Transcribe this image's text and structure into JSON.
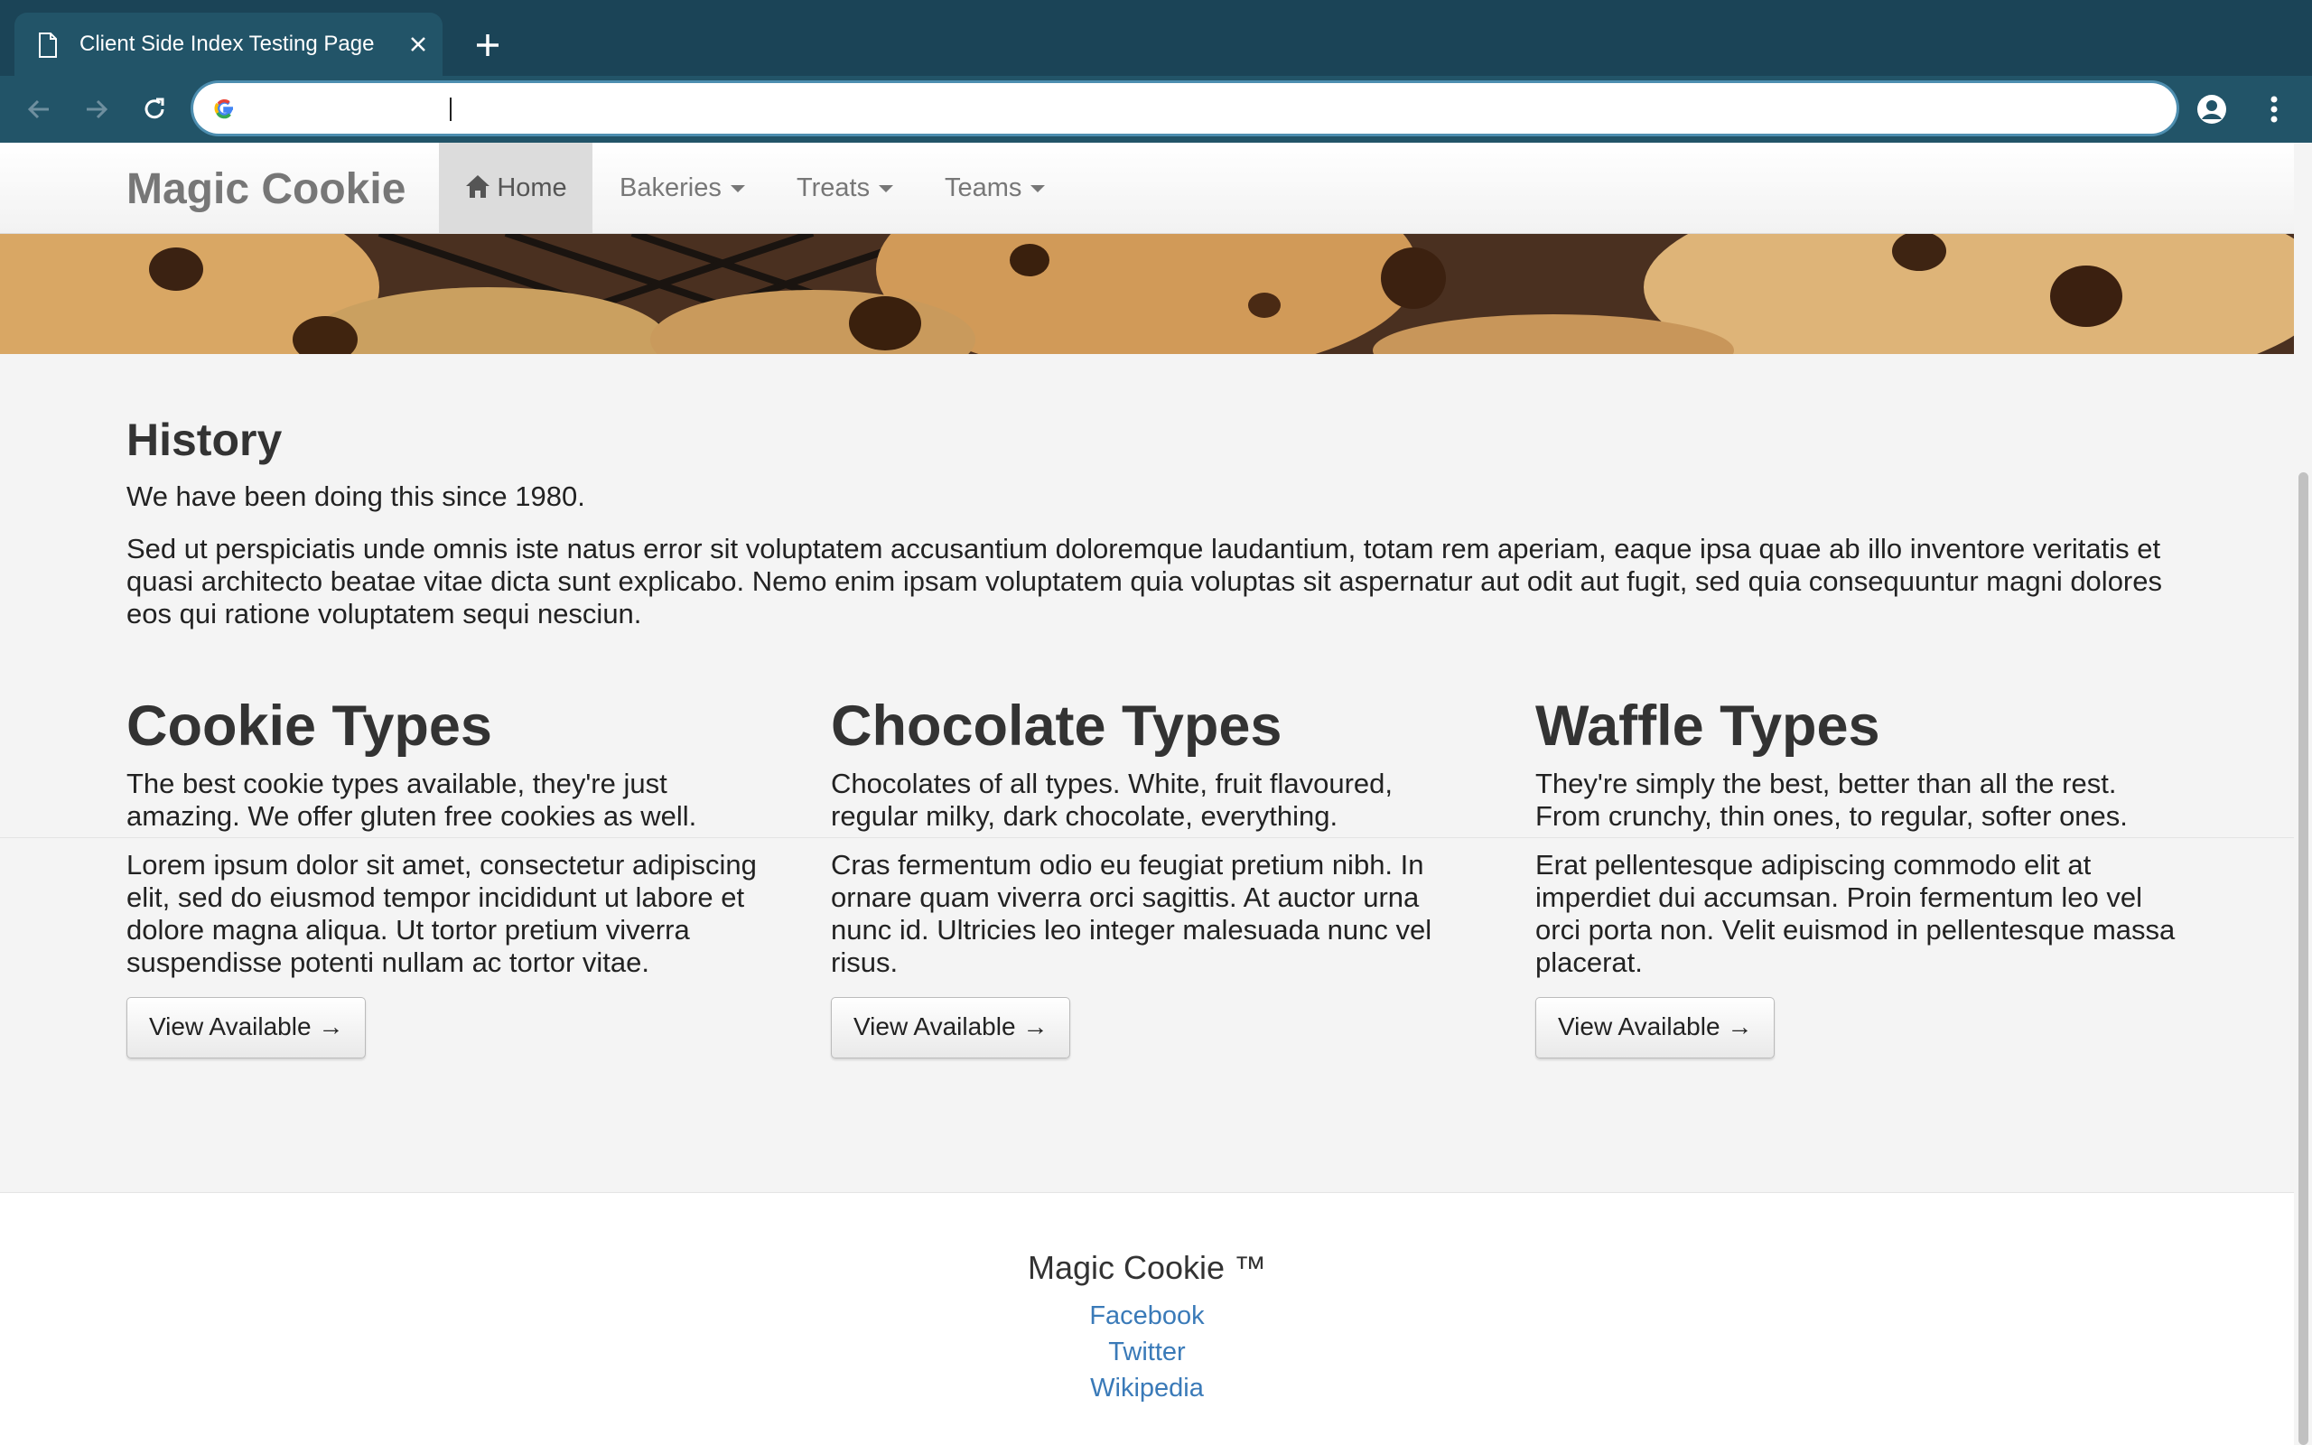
{
  "browser": {
    "tab_title": "Client Side Index Testing Page",
    "address_value": "",
    "accent_color": "#1b4457"
  },
  "nav": {
    "brand": "Magic Cookie",
    "items": [
      {
        "label": "Home",
        "icon": "home-icon",
        "active": true
      },
      {
        "label": "Bakeries",
        "dropdown": true
      },
      {
        "label": "Treats",
        "dropdown": true
      },
      {
        "label": "Teams",
        "dropdown": true
      }
    ]
  },
  "history": {
    "title": "History",
    "lead": "We have been doing this since 1980.",
    "body": "Sed ut perspiciatis unde omnis iste natus error sit voluptatem accusantium doloremque laudantium, totam rem aperiam, eaque ipsa quae ab illo inventore veritatis et quasi architecto beatae vitae dicta sunt explicabo. Nemo enim ipsam voluptatem quia voluptas sit aspernatur aut odit aut fugit, sed quia consequuntur magni dolores eos qui ratione voluptatem sequi nesciun."
  },
  "columns": [
    {
      "title": "Cookie Types",
      "intro": "The best cookie types available, they're just amazing. We offer gluten free cookies as well.",
      "body": "Lorem ipsum dolor sit amet, consectetur adipiscing elit, sed do eiusmod tempor incididunt ut labore et dolore magna aliqua. Ut tortor pretium viverra suspendisse potenti nullam ac tortor vitae.",
      "button": "View Available →"
    },
    {
      "title": "Chocolate Types",
      "intro": "Chocolates of all types. White, fruit flavoured, regular milky, dark chocolate, everything.",
      "body": "Cras fermentum odio eu feugiat pretium nibh. In ornare quam viverra orci sagittis. At auctor urna nunc id. Ultricies leo integer malesuada nunc vel risus.",
      "button": "View Available →"
    },
    {
      "title": "Waffle Types",
      "intro": "They're simply the best, better than all the rest. From crunchy, thin ones, to regular, softer ones.",
      "body": "Erat pellentesque adipiscing commodo elit at imperdiet dui accumsan. Proin fermentum leo vel orci porta non. Velit euismod in pellentesque massa placerat.",
      "button": "View Available →"
    }
  ],
  "footer": {
    "brand": "Magic Cookie ™",
    "links": [
      "Facebook",
      "Twitter",
      "Wikipedia"
    ]
  }
}
